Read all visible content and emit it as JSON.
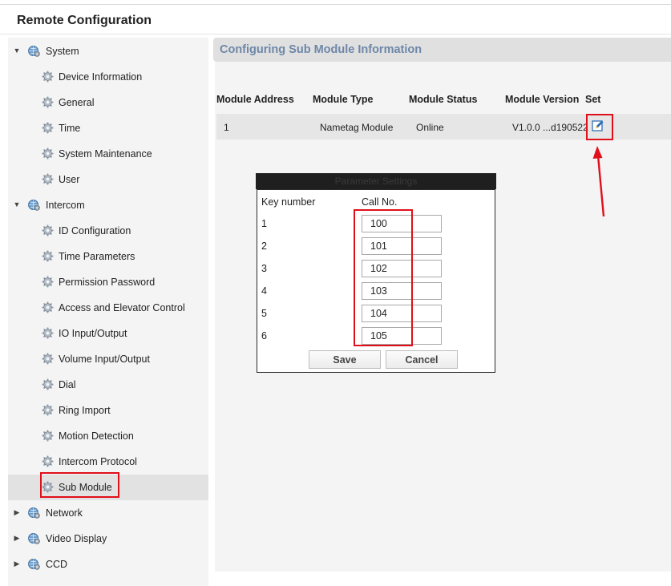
{
  "window": {
    "title": "Remote Configuration"
  },
  "sidebar": {
    "items": [
      {
        "label": "System",
        "level": 0,
        "expanded": true
      },
      {
        "label": "Device Information",
        "level": 1
      },
      {
        "label": "General",
        "level": 1
      },
      {
        "label": "Time",
        "level": 1
      },
      {
        "label": "System Maintenance",
        "level": 1
      },
      {
        "label": "User",
        "level": 1
      },
      {
        "label": "Intercom",
        "level": 0,
        "expanded": true
      },
      {
        "label": "ID Configuration",
        "level": 1
      },
      {
        "label": "Time Parameters",
        "level": 1
      },
      {
        "label": "Permission Password",
        "level": 1
      },
      {
        "label": "Access and Elevator Control",
        "level": 1
      },
      {
        "label": "IO Input/Output",
        "level": 1
      },
      {
        "label": "Volume Input/Output",
        "level": 1
      },
      {
        "label": "Dial",
        "level": 1
      },
      {
        "label": "Ring Import",
        "level": 1
      },
      {
        "label": "Motion Detection",
        "level": 1
      },
      {
        "label": "Intercom Protocol",
        "level": 1
      },
      {
        "label": "Sub Module",
        "level": 1,
        "selected": true
      },
      {
        "label": "Network",
        "level": 0,
        "expanded": false
      },
      {
        "label": "Video Display",
        "level": 0,
        "expanded": false
      },
      {
        "label": "CCD",
        "level": 0,
        "expanded": false
      }
    ]
  },
  "main": {
    "section_title": "Configuring Sub Module Information",
    "table": {
      "headers": [
        "Module Address",
        "Module Type",
        "Module Status",
        "Module Version",
        "Set"
      ],
      "rows": [
        {
          "address": "1",
          "type": "Nametag Module",
          "status": "Online",
          "version": "V1.0.0 ...d190522",
          "set_icon": "edit-icon"
        }
      ]
    }
  },
  "dialog": {
    "title": "Parameter Settings",
    "col_key": "Key number",
    "col_call": "Call No.",
    "rows": [
      {
        "key": "1",
        "call": "100"
      },
      {
        "key": "2",
        "call": "101"
      },
      {
        "key": "3",
        "call": "102"
      },
      {
        "key": "4",
        "call": "103"
      },
      {
        "key": "5",
        "call": "104"
      },
      {
        "key": "6",
        "call": "105"
      }
    ],
    "save_label": "Save",
    "cancel_label": "Cancel"
  },
  "colors": {
    "highlight": "#e0101a",
    "section_title": "#6e87a8",
    "edit_icon": "#2f6fb5"
  }
}
